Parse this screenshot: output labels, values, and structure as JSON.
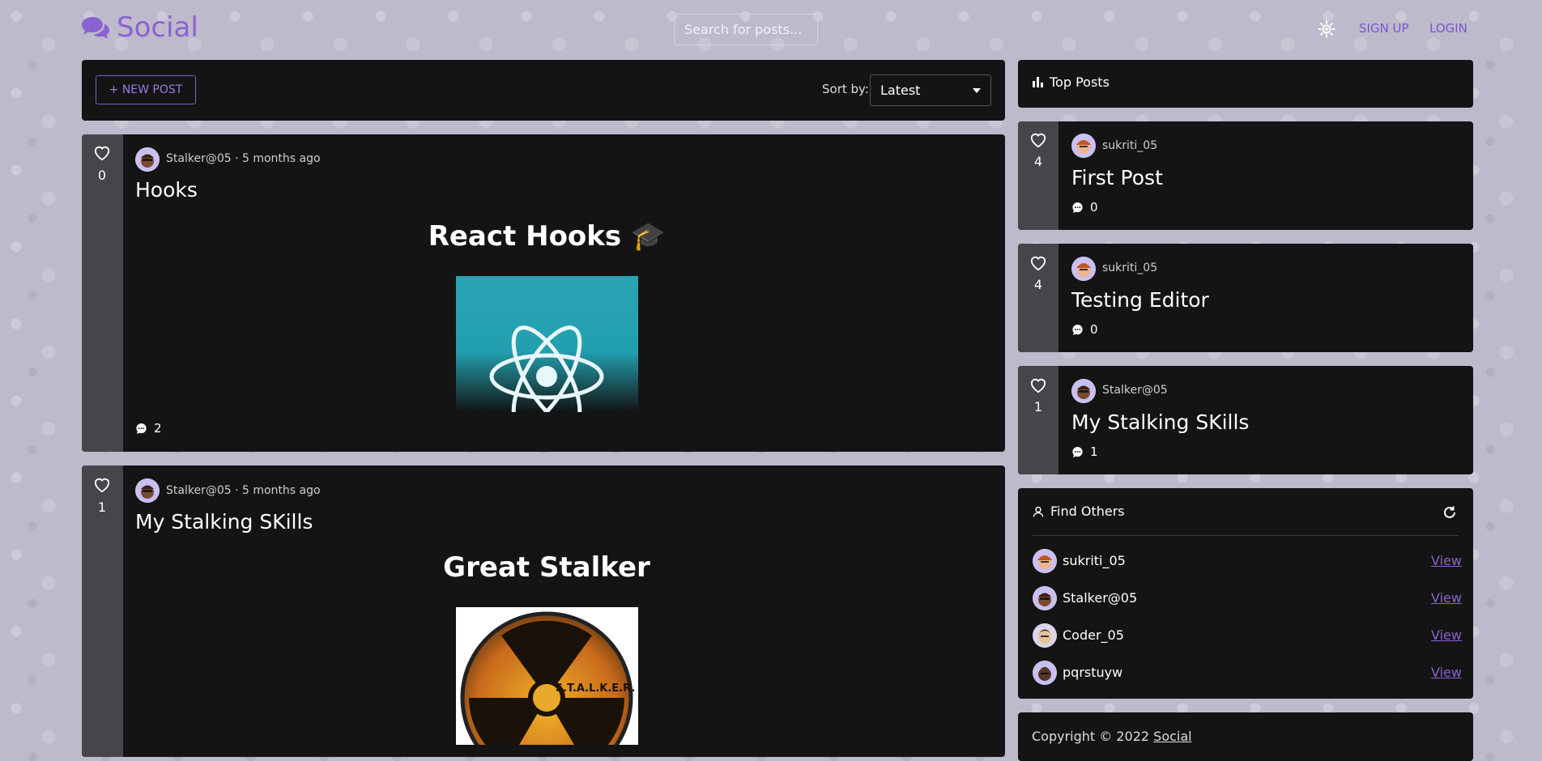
{
  "header": {
    "brand": "Social",
    "search_placeholder": "Search for posts...",
    "signup_label": "SIGN UP",
    "login_label": "LOGIN",
    "accent_color": "#8a63d2"
  },
  "toolbar": {
    "new_post_label": "+ NEW POST",
    "sort_label": "Sort by:",
    "sort_value": "Latest"
  },
  "posts": [
    {
      "likes": "0",
      "author": "Stalker@05",
      "time": "· 5 months ago",
      "title": "Hooks",
      "heading": "React Hooks 🎓",
      "image_icon": "react-logo-image",
      "comments": "2"
    },
    {
      "likes": "1",
      "author": "Stalker@05",
      "time": "· 5 months ago",
      "title": "My Stalking SKills",
      "heading": "Great Stalker",
      "image_icon": "stalker-radiation-image",
      "image_text": "S.T.A.L.K.E.R.",
      "comments": ""
    }
  ],
  "top_posts": {
    "title": "Top Posts",
    "items": [
      {
        "likes": "4",
        "author": "sukriti_05",
        "title": "First Post",
        "comments": "0"
      },
      {
        "likes": "4",
        "author": "sukriti_05",
        "title": "Testing Editor",
        "comments": "0"
      },
      {
        "likes": "1",
        "author": "Stalker@05",
        "title": "My Stalking SKills",
        "comments": "1"
      }
    ]
  },
  "find_others": {
    "title": "Find Others",
    "users": [
      {
        "name": "sukriti_05",
        "view": "View"
      },
      {
        "name": "Stalker@05",
        "view": "View"
      },
      {
        "name": "Coder_05",
        "view": "View"
      },
      {
        "name": "pqrstuyw",
        "view": "View"
      }
    ]
  },
  "footer": {
    "copyright": "Copyright © 2022",
    "link": "Social"
  }
}
